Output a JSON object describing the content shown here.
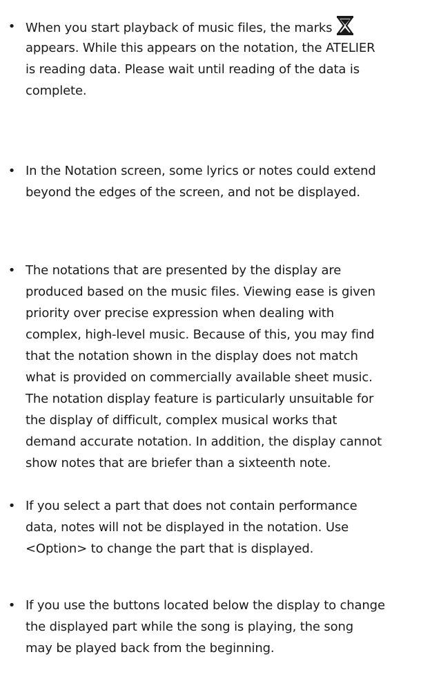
{
  "notes": [
    {
      "lines": [
        "When you start playback of music files, the marks",
        "appears. While this appears on the notation, the ATELIER",
        "is reading data. Please wait until reading of the data is",
        "complete."
      ],
      "icon": "hourglass-icon"
    },
    {
      "lines": [
        "In the Notation screen, some lyrics or notes could extend",
        "beyond the edges of the screen, and not be displayed."
      ]
    },
    {
      "lines": [
        "The notations that are presented by the display are",
        "produced based on the music files. Viewing ease is given",
        "priority over precise expression when dealing with",
        "complex, high-level music. Because of this, you may find",
        "that the notation shown in the display does not match",
        "what is provided on commercially available sheet music.",
        "The notation display feature is particularly unsuitable for",
        "the display of difficult, complex musical works that",
        "demand accurate notation. In addition, the display cannot",
        "show notes that are briefer than a sixteenth note."
      ]
    },
    {
      "lines": [
        "If you select a part that does not contain performance",
        "data, notes will not be displayed in the notation. Use",
        "<Option> to change the part that is displayed."
      ]
    },
    {
      "lines": [
        "If you use the buttons located below the display to change",
        "the displayed part while the song is playing, the song",
        "may be played back from the beginning."
      ]
    }
  ]
}
